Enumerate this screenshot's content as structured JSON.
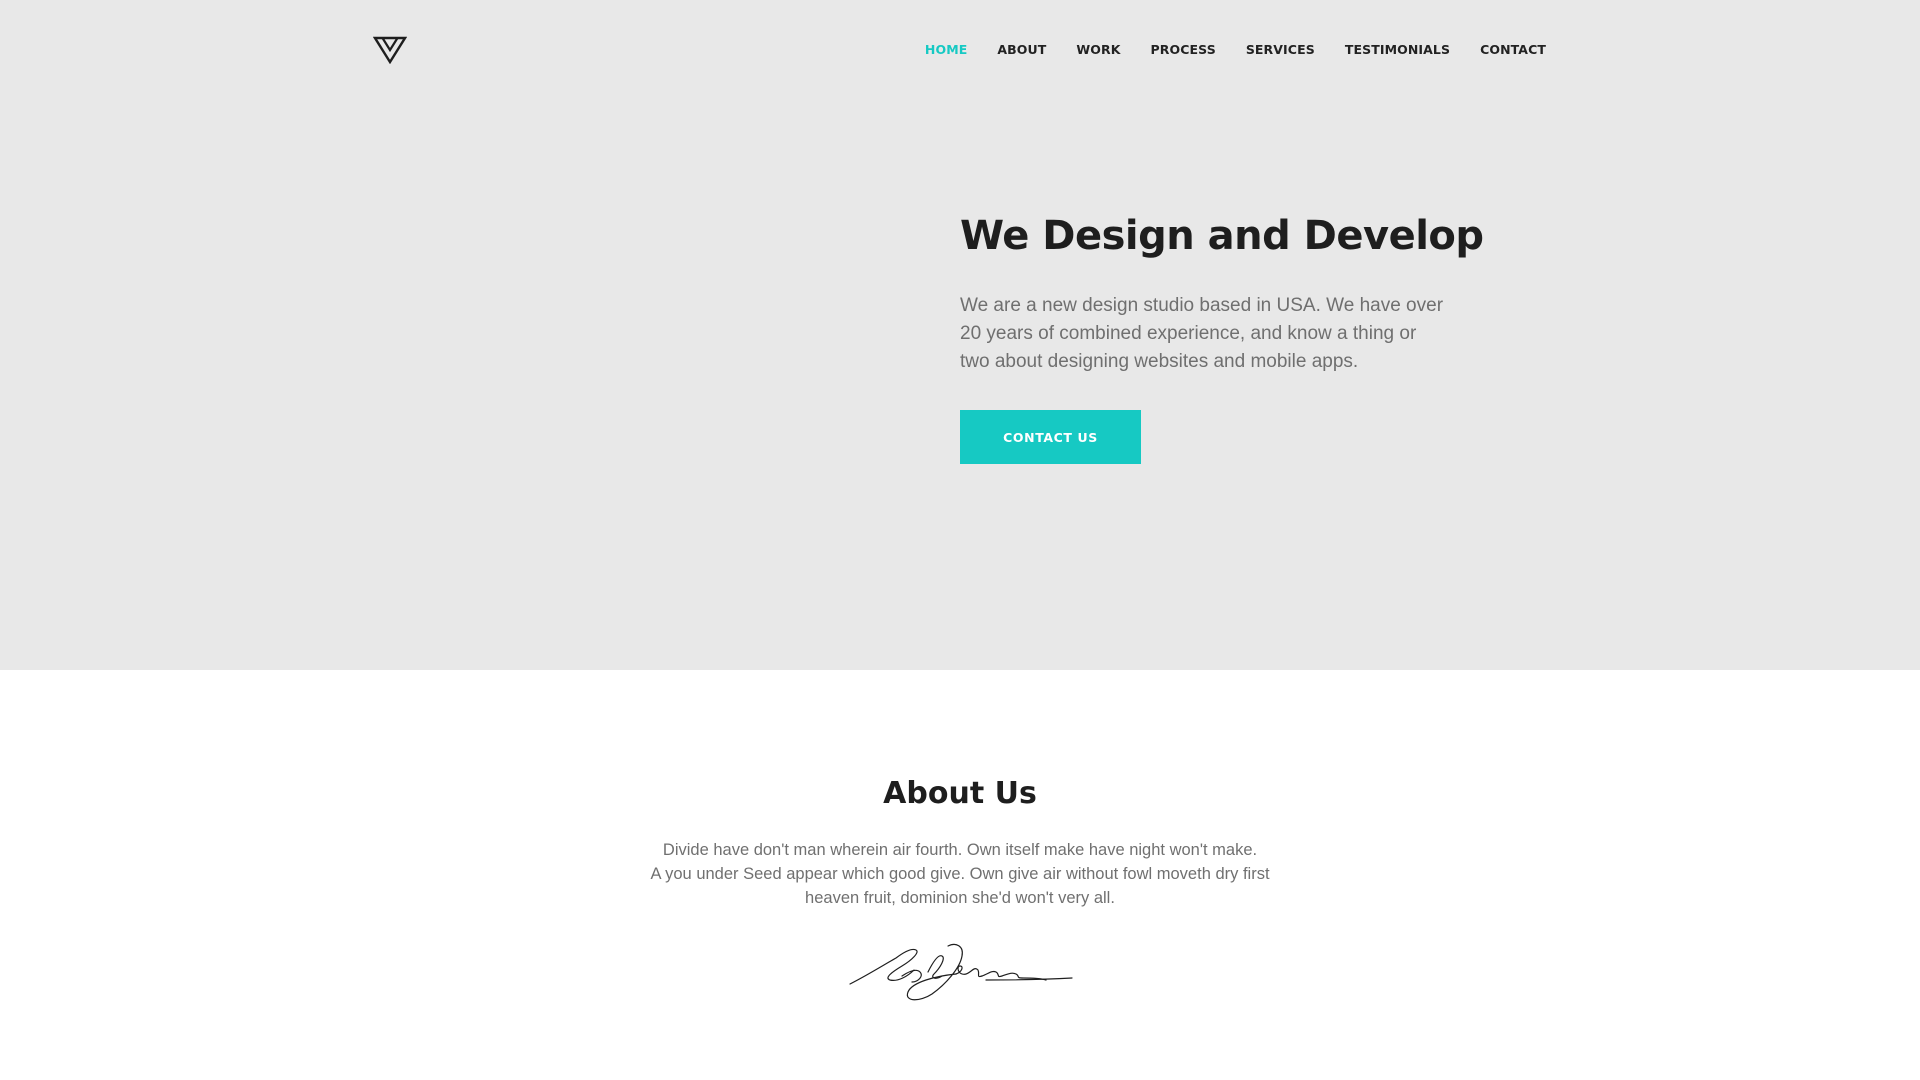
{
  "logo": {
    "icon": "triangle-logo-icon"
  },
  "nav": {
    "items": [
      "HOME",
      "ABOUT",
      "WORK",
      "PROCESS",
      "SERVICES",
      "TESTIMONIALS",
      "CONTACT"
    ],
    "active": "HOME"
  },
  "hero": {
    "title": "We Design and Develop",
    "description": "We are a new design studio based in USA. We have over 20 years of combined experience, and know a thing or two about designing websites and mobile apps.",
    "cta_label": "CONTACT US"
  },
  "about": {
    "title": "About Us",
    "lines": [
      "Divide have don't man wherein air fourth. Own itself make have night won't make.",
      "A you under Seed appear which good give. Own give air without fowl moveth dry first",
      "heaven fruit, dominion she'd won't very all."
    ],
    "signature_icon": "handwritten-signature-icon"
  },
  "colors": {
    "accent": "#16c9c3",
    "hero_background": "#e8e8e8",
    "heading": "#1e1e1e",
    "body_text": "#707070"
  }
}
